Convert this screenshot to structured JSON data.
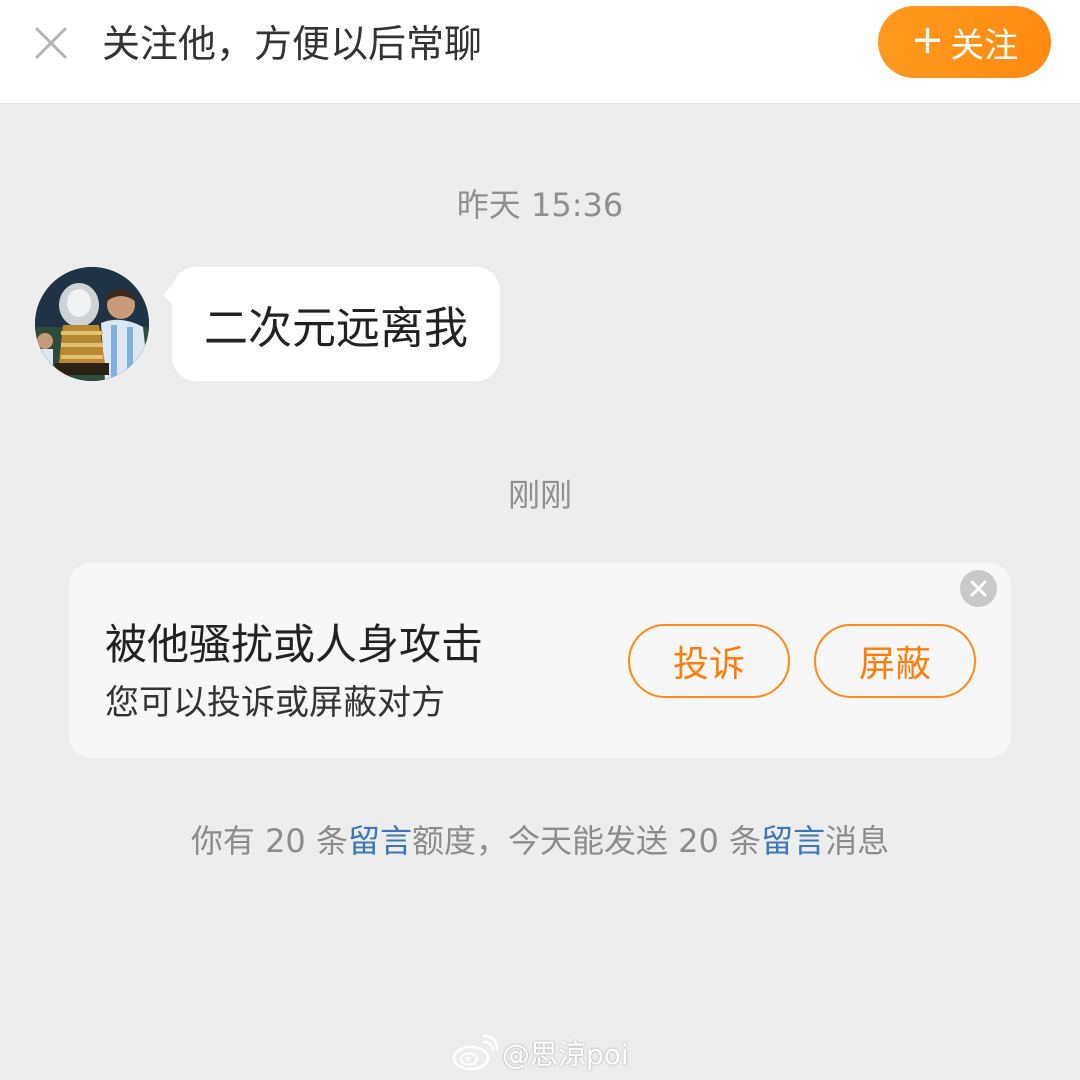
{
  "header": {
    "follow_prompt": "关注他，方便以后常聊",
    "follow_button": {
      "icon": "+",
      "label": "关注"
    },
    "close_icon": "close-icon",
    "accent_color": "#ff8c16"
  },
  "chat": {
    "messages": [
      {
        "time": "昨天 15:36",
        "sender": "other",
        "avatar": "avatar-photo",
        "text": "二次元远离我"
      }
    ],
    "notice_time": "刚刚"
  },
  "report_card": {
    "title": "被他骚扰或人身攻击",
    "subtitle": "您可以投诉或屏蔽对方",
    "complain_label": "投诉",
    "block_label": "屏蔽",
    "close_icon": "close-circle-icon"
  },
  "quota": {
    "parts": [
      "你有 20 条",
      "留言",
      "额度，今天能发送 20 条",
      "留言",
      "消息"
    ],
    "link_color": "#3d76b6"
  },
  "watermark": {
    "logo": "weibo-logo",
    "text": "@思涼poi"
  }
}
